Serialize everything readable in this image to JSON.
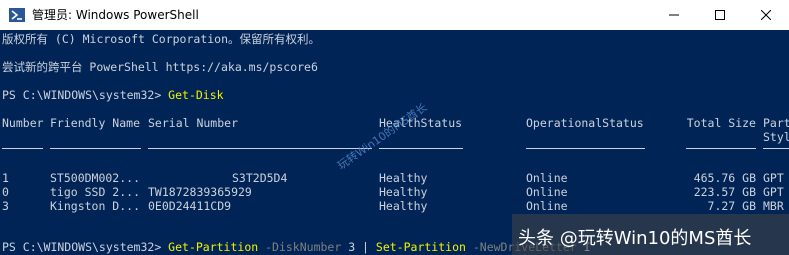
{
  "window": {
    "title": "管理员: Windows PowerShell",
    "icon": "powershell-icon",
    "controls": [
      "minimize-icon",
      "maximize-icon",
      "close-icon"
    ]
  },
  "console": {
    "copyright": "版权所有 (C) Microsoft Corporation。保留所有权利。",
    "try_new": "尝试新的跨平台 PowerShell https://aka.ms/pscore6",
    "prompt1": "PS C:\\WINDOWS\\system32> ",
    "command1": "Get-Disk",
    "headers": {
      "number": "Number",
      "friendly_name": "Friendly Name",
      "serial_number": "Serial Number",
      "health": "HealthStatus",
      "operational": "OperationalStatus",
      "total_size": "Total Size",
      "partition_style_1": "Part",
      "partition_style_2": "Styl"
    },
    "rows": [
      {
        "number": "1",
        "friendly_name": "ST500DM002...",
        "serial_number": "S3T2D5D4",
        "health": "Healthy",
        "operational": "Online",
        "total_size": "465.76 GB",
        "partition_style": "GPT"
      },
      {
        "number": "0",
        "friendly_name": "tigo SSD 2...",
        "serial_number": "TW1872839365929",
        "health": "Healthy",
        "operational": "Online",
        "total_size": "223.57 GB",
        "partition_style": "GPT"
      },
      {
        "number": "3",
        "friendly_name": "Kingston D...",
        "serial_number": "0E0D24411CD9",
        "health": "Healthy",
        "operational": "Online",
        "total_size": "7.27 GB",
        "partition_style": "MBR"
      }
    ],
    "prompt2": "PS C:\\WINDOWS\\system32> ",
    "command2_part1": "Get-Partition",
    "command2_param1": " -DiskNumber",
    "command2_value1": " 3 | ",
    "command2_part2": "Set-Partition",
    "command2_param2": " -NewDriveLetter",
    "command2_value2": " I"
  },
  "watermarks": {
    "diagonal": "玩转Win10的MS酋长",
    "badge": "头条 @玩转Win10的MS酋长"
  }
}
